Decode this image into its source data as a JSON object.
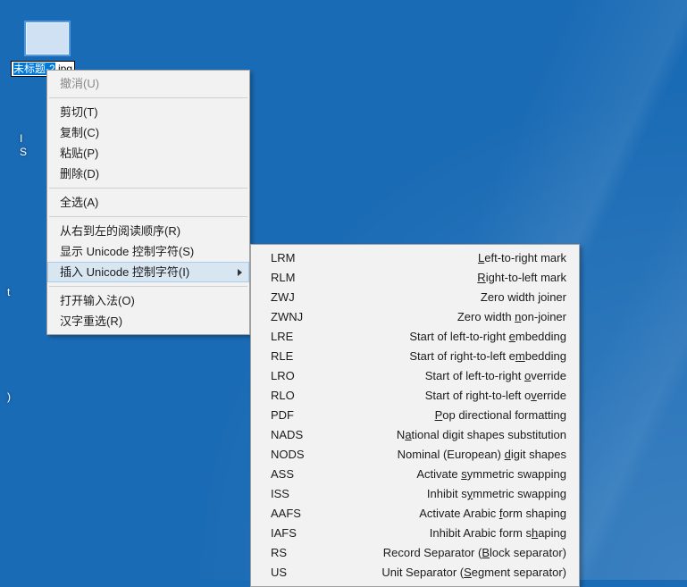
{
  "rename": {
    "selected": "未标题-2",
    "ext": ".jpg"
  },
  "stray": {
    "line1": "I",
    "line2": "S",
    "line3": "t",
    "line4": ")"
  },
  "menu": {
    "undo": "撤消(U)",
    "cut": "剪切(T)",
    "copy": "复制(C)",
    "paste": "粘贴(P)",
    "delete": "删除(D)",
    "selectAll": "全选(A)",
    "rtl": "从右到左的阅读顺序(R)",
    "showUcc": "显示 Unicode 控制字符(S)",
    "insertUcc": "插入 Unicode 控制字符(I)",
    "openIme": "打开输入法(O)",
    "reconv": "汉字重选(R)"
  },
  "submenu": [
    {
      "code": "LRM",
      "desc_pre": "",
      "u": "L",
      "desc_post": "eft-to-right mark"
    },
    {
      "code": "RLM",
      "desc_pre": "",
      "u": "R",
      "desc_post": "ight-to-left mark"
    },
    {
      "code": "ZWJ",
      "desc_pre": "Zero width ",
      "u": "j",
      "desc_post": "oiner"
    },
    {
      "code": "ZWNJ",
      "desc_pre": "Zero width ",
      "u": "n",
      "desc_post": "on-joiner"
    },
    {
      "code": "LRE",
      "desc_pre": "Start of left-to-right ",
      "u": "e",
      "desc_post": "mbedding"
    },
    {
      "code": "RLE",
      "desc_pre": "Start of right-to-left e",
      "u": "m",
      "desc_post": "bedding"
    },
    {
      "code": "LRO",
      "desc_pre": "Start of left-to-right ",
      "u": "o",
      "desc_post": "verride"
    },
    {
      "code": "RLO",
      "desc_pre": "Start of right-to-left o",
      "u": "v",
      "desc_post": "erride"
    },
    {
      "code": "PDF",
      "desc_pre": "",
      "u": "P",
      "desc_post": "op directional formatting"
    },
    {
      "code": "NADS",
      "desc_pre": "N",
      "u": "a",
      "desc_post": "tional digit shapes substitution"
    },
    {
      "code": "NODS",
      "desc_pre": "Nominal (European) ",
      "u": "d",
      "desc_post": "igit shapes"
    },
    {
      "code": "ASS",
      "desc_pre": "Activate ",
      "u": "s",
      "desc_post": "ymmetric swapping"
    },
    {
      "code": "ISS",
      "desc_pre": "Inhibit s",
      "u": "y",
      "desc_post": "mmetric swapping"
    },
    {
      "code": "AAFS",
      "desc_pre": "Activate Arabic ",
      "u": "f",
      "desc_post": "orm shaping"
    },
    {
      "code": "IAFS",
      "desc_pre": "Inhibit Arabic form s",
      "u": "h",
      "desc_post": "aping"
    },
    {
      "code": "RS",
      "desc_pre": "Record Separator (",
      "u": "B",
      "desc_post": "lock separator)"
    },
    {
      "code": "US",
      "desc_pre": "Unit Separator (",
      "u": "S",
      "desc_post": "egment separator)"
    }
  ]
}
